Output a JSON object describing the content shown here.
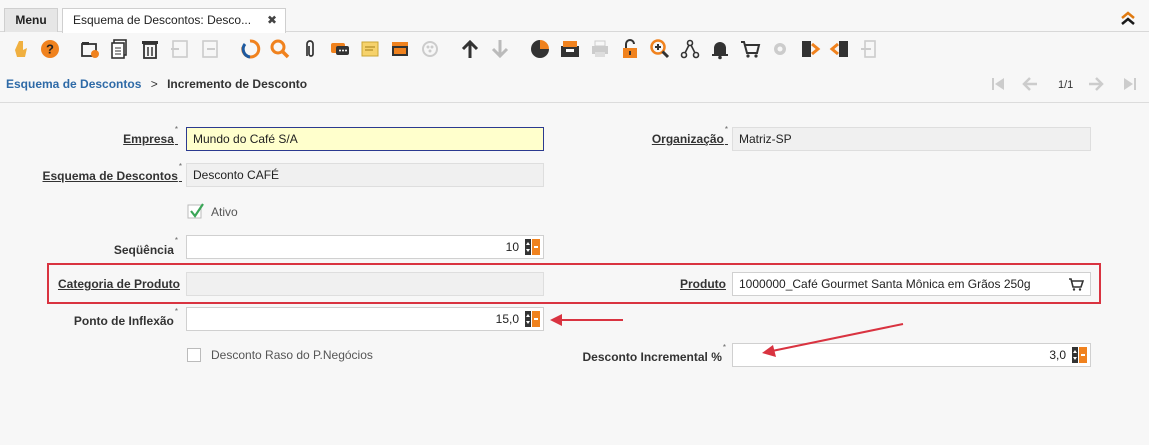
{
  "tabs": {
    "menu_label": "Menu",
    "doc_label": "Esquema de Descontos: Desco...",
    "close_glyph": "✖"
  },
  "toolbar": {
    "icons": [
      "lookup-icon",
      "help-icon",
      "new-icon",
      "copy-icon",
      "delete-icon",
      "save-icon",
      "undo-icon",
      "refresh-icon",
      "find-icon",
      "attachment-icon",
      "chat-icon",
      "postit-icon",
      "report-icon",
      "archive-icon",
      "up-icon",
      "down-icon",
      "chart-icon",
      "requests-icon",
      "print-icon",
      "lock-icon",
      "zoom-across-icon",
      "workflow-icon",
      "notice-icon",
      "product-info-icon",
      "settings-icon",
      "export-icon",
      "import-icon",
      "exit-icon"
    ]
  },
  "breadcrumb": {
    "parent": "Esquema de Descontos",
    "separator": ">",
    "current": "Incremento de Desconto"
  },
  "pager": {
    "text": "1/1"
  },
  "form": {
    "empresa_label": "Empresa",
    "empresa_value": "Mundo do Café S/A",
    "organizacao_label": "Organização",
    "organizacao_value": "Matriz-SP",
    "esquema_label": "Esquema de Descontos",
    "esquema_value": "Desconto CAFÉ",
    "ativo_label": "Ativo",
    "ativo_checked": true,
    "sequencia_label": "Seqüência",
    "sequencia_value": "10",
    "categoria_label": "Categoria de Produto",
    "categoria_value": "",
    "produto_label": "Produto",
    "produto_value": "1000000_Café Gourmet Santa Mônica em Grãos 250g",
    "ponto_label": "Ponto de Inflexão",
    "ponto_value": "15,0",
    "desconto_raso_label": "Desconto Raso do P.Negócios",
    "desconto_raso_checked": false,
    "desconto_incremental_label": "Desconto Incremental %",
    "desconto_incremental_value": "3,0",
    "required_mark": "*"
  },
  "colors": {
    "accent_orange": "#f0821e",
    "link_blue": "#2e6aa7",
    "annotation_red": "#d93340",
    "active_field_bg": "#ffffcc",
    "check_green": "#3aa657"
  }
}
